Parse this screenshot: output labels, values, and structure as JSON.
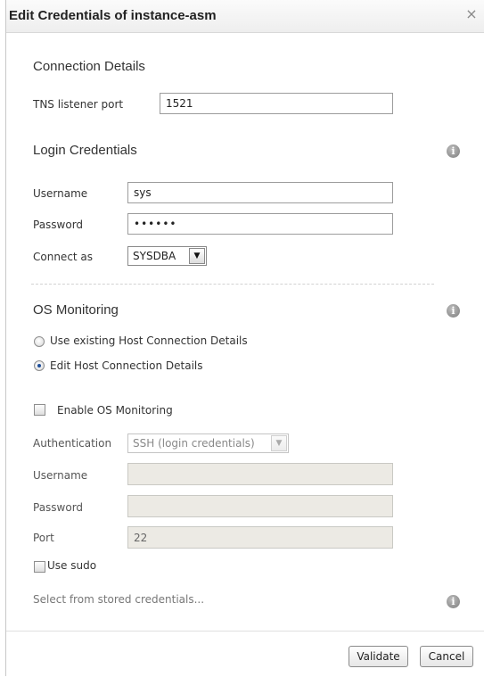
{
  "dialog": {
    "title": "Edit Credentials of instance-asm",
    "close_icon": "×"
  },
  "connection": {
    "heading": "Connection Details",
    "tns_label": "TNS listener port",
    "tns_value": "1521"
  },
  "login": {
    "heading": "Login Credentials",
    "username_label": "Username",
    "username_value": "sys",
    "password_label": "Password",
    "password_value": "••••••",
    "connect_label": "Connect as",
    "connect_value": "SYSDBA"
  },
  "os": {
    "heading": "OS Monitoring",
    "radio_existing": "Use existing Host Connection Details",
    "radio_edit": "Edit Host Connection Details",
    "selected_radio": "edit",
    "enable_label": "Enable OS Monitoring",
    "enable_checked": false,
    "auth_label": "Authentication",
    "auth_value": "SSH (login credentials)",
    "username_label": "Username",
    "username_value": "",
    "password_label": "Password",
    "password_value": "",
    "port_label": "Port",
    "port_value": "22",
    "sudo_label": "Use sudo",
    "sudo_checked": false,
    "stored_link": "Select from stored credentials..."
  },
  "icons": {
    "info": "i",
    "dropdown": "▼"
  },
  "footer": {
    "validate_label": "Validate",
    "cancel_label": "Cancel"
  },
  "colors": {
    "radio_selected": "#1f4f9a",
    "disabled_field": "#eceae4"
  }
}
